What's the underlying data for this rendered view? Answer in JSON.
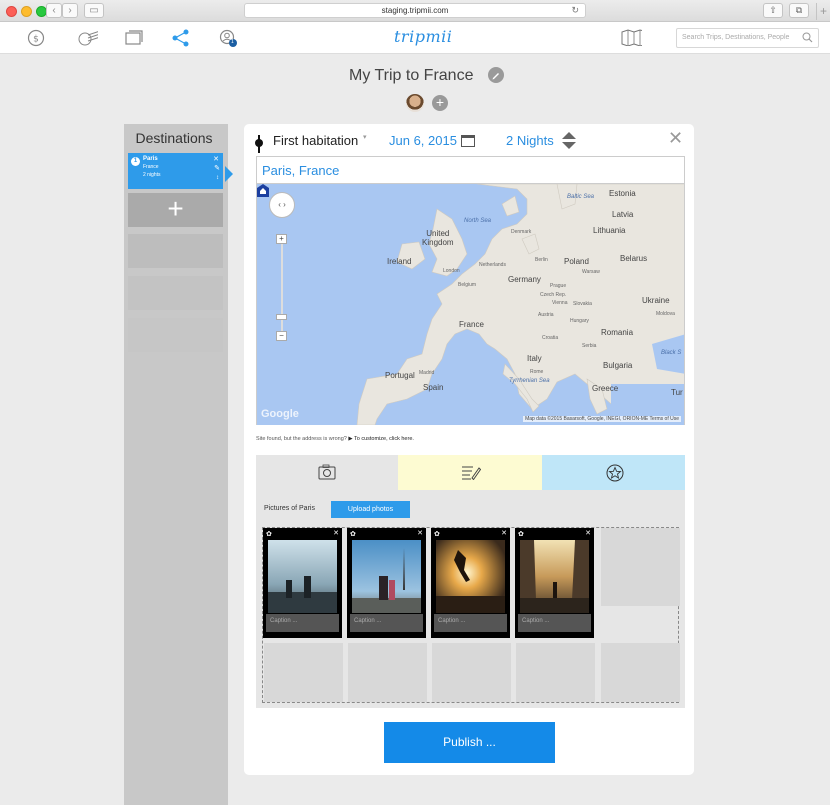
{
  "browser": {
    "url": "staging.tripmii.com"
  },
  "header": {
    "logo": "tripmii",
    "search_placeholder": "Search Trips, Destinations, People",
    "notification_count": "1"
  },
  "trip": {
    "title": "My Trip to France"
  },
  "sidebar": {
    "title": "Destinations",
    "items": [
      {
        "number": "1",
        "city": "Paris",
        "country": "France",
        "nights": "2 nights"
      }
    ]
  },
  "stop": {
    "type": "First habitation",
    "date": "Jun 6, 2015",
    "nights": "2 Nights",
    "location": "Paris, France"
  },
  "map": {
    "labels": {
      "north_sea": "North Sea",
      "baltic_sea": "Baltic Sea",
      "estonia": "Estonia",
      "latvia": "Latvia",
      "lithuania": "Lithuania",
      "denmark": "Denmark",
      "united_kingdom": "United\nKingdom",
      "ireland": "Ireland",
      "london": "London",
      "netherlands": "Netherlands",
      "berlin": "Berlin",
      "poland": "Poland",
      "warsaw": "Warsaw",
      "belarus": "Belarus",
      "germany": "Germany",
      "belgium": "Belgium",
      "prague": "Prague",
      "czech_rep": "Czech Rep.",
      "vienna": "Vienna",
      "slovakia": "Slovakia",
      "ukraine": "Ukraine",
      "france": "France",
      "austria": "Austria",
      "hungary": "Hungary",
      "moldova": "Moldova",
      "croatia": "Croatia",
      "romania": "Romania",
      "serbia": "Serbia",
      "italy": "Italy",
      "black_sea": "Black S",
      "bulgaria": "Bulgaria",
      "portugal": "Portugal",
      "madrid": "Madrid",
      "spain": "Spain",
      "rome": "Rome",
      "tyrrhenian_sea": "Tyrrhenian Sea",
      "greece": "Greece",
      "turkey": "Tur"
    },
    "google": "Google",
    "attribution": "Map data ©2015 Basarsoft, Google, INEGI, ORION-ME   Terms of Use",
    "note": "Site found, but the address is wrong?",
    "note_link": "▶ To customize, click here."
  },
  "photos": {
    "label": "Pictures of Paris",
    "upload_label": "Upload photos",
    "items": [
      {
        "caption": "Caption ..."
      },
      {
        "caption": "Caption ..."
      },
      {
        "caption": "Caption ..."
      },
      {
        "caption": "Caption ..."
      }
    ]
  },
  "publish_label": "Publish ...",
  "colors": {
    "accent": "#2e9bea",
    "publish": "#148ae8",
    "notes_tab": "#fdfbd2",
    "reviews_tab": "#bfe6f8"
  }
}
